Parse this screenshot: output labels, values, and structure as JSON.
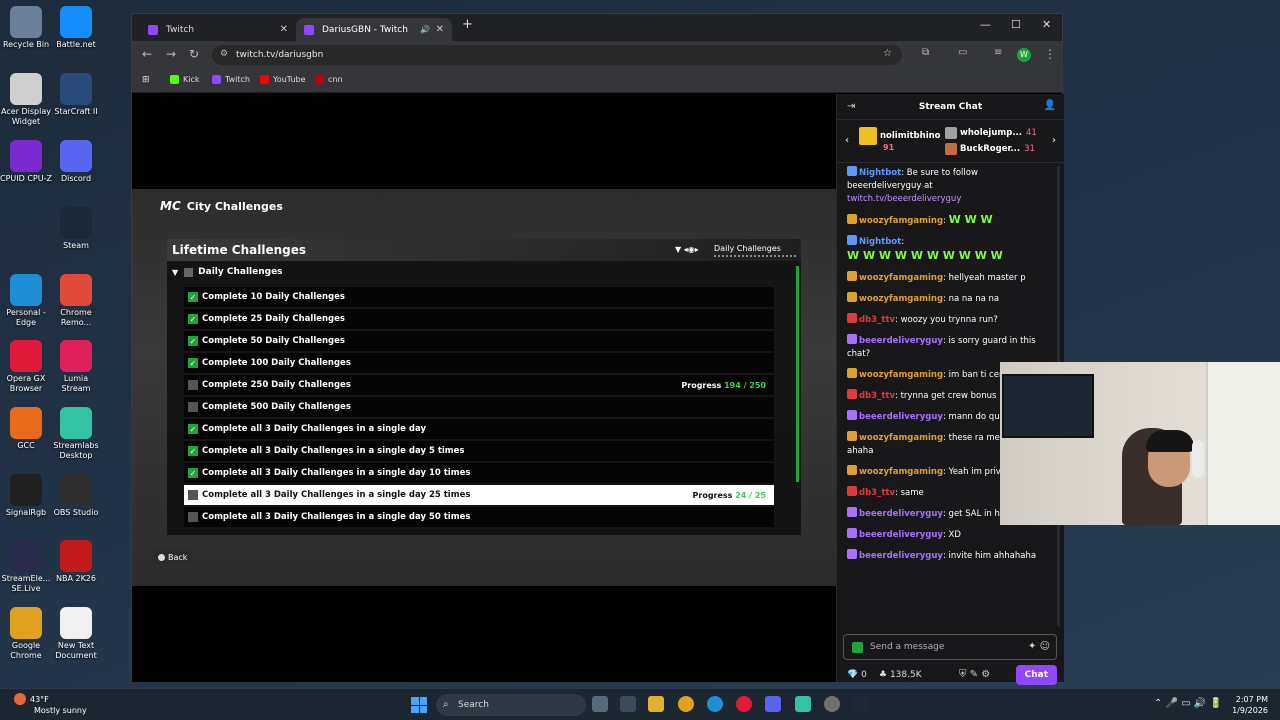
{
  "desktop": {
    "icons": [
      {
        "label": "Recycle Bin",
        "color": "#6b7f99"
      },
      {
        "label": "Battle.net",
        "color": "#148eff"
      },
      {
        "label": "Acer Display Widget",
        "color": "#cfcfcf"
      },
      {
        "label": "StarCraft II",
        "color": "#2a4a7a"
      },
      {
        "label": "CPUID CPU-Z",
        "color": "#7a2ad0"
      },
      {
        "label": "Discord",
        "color": "#5865f2"
      },
      {
        "label": "Steam",
        "color": "#1b2838"
      },
      {
        "label": "Personal - Edge",
        "color": "#1e8fd6"
      },
      {
        "label": "Chrome Remo...",
        "color": "#e04a3a"
      },
      {
        "label": "Opera GX Browser",
        "color": "#e01a3a"
      },
      {
        "label": "Lumia Stream",
        "color": "#e0205a"
      },
      {
        "label": "GCC",
        "color": "#e86a1a"
      },
      {
        "label": "Streamlabs Desktop",
        "color": "#31c3a2"
      },
      {
        "label": "SignalRgb",
        "color": "#202020"
      },
      {
        "label": "OBS Studio",
        "color": "#303030"
      },
      {
        "label": "StreamEle... SE.Live",
        "color": "#2a2a4a"
      },
      {
        "label": "NBA 2K26",
        "color": "#c01a1a"
      },
      {
        "label": "Google Chrome",
        "color": "#e0a020"
      },
      {
        "label": "New Text Document",
        "color": "#f0f0f0"
      }
    ]
  },
  "browser": {
    "tabs": [
      {
        "title": "Twitch",
        "close": "✕"
      },
      {
        "title": "DariusGBN - Twitch",
        "close": "✕",
        "audio": "🔊"
      }
    ],
    "new_tab": "+",
    "window_controls": {
      "minimize": "—",
      "maximize": "☐",
      "close": "✕"
    },
    "url": "twitch.tv/dariusgbn",
    "nav": {
      "back": "←",
      "forward": "→",
      "reload": "↻"
    },
    "profile_initial": "W",
    "bookmarks": [
      {
        "label": "Kick",
        "color": "#53fc18"
      },
      {
        "label": "Twitch",
        "color": "#9146ff"
      },
      {
        "label": "YouTube",
        "color": "#ff0000"
      },
      {
        "label": "cnn",
        "color": "#cc0000"
      }
    ]
  },
  "game": {
    "logo": "MC",
    "title": "City Challenges",
    "panel_title": "Lifetime Challenges",
    "category": "Daily Challenges",
    "section": "Daily Challenges",
    "rows": [
      {
        "label": "Complete 10 Daily Challenges",
        "done": true,
        "progress_label": "",
        "progress_value": ""
      },
      {
        "label": "Complete 25 Daily Challenges",
        "done": true,
        "progress_label": "",
        "progress_value": ""
      },
      {
        "label": "Complete 50 Daily Challenges",
        "done": true,
        "progress_label": "",
        "progress_value": ""
      },
      {
        "label": "Complete 100 Daily Challenges",
        "done": true,
        "progress_label": "",
        "progress_value": ""
      },
      {
        "label": "Complete 250 Daily Challenges",
        "done": false,
        "progress_label": "Progress",
        "progress_value": "194 / 250"
      },
      {
        "label": "Complete 500 Daily Challenges",
        "done": false,
        "progress_label": "",
        "progress_value": ""
      },
      {
        "label": "Complete all 3 Daily Challenges in a single day",
        "done": true,
        "progress_label": "",
        "progress_value": ""
      },
      {
        "label": "Complete all 3 Daily Challenges in a single day 5 times",
        "done": true,
        "progress_label": "",
        "progress_value": ""
      },
      {
        "label": "Complete all 3 Daily Challenges in a single day 10 times",
        "done": true,
        "progress_label": "",
        "progress_value": ""
      },
      {
        "label": "Complete all 3 Daily Challenges in a single day 25 times",
        "done": false,
        "selected": true,
        "progress_label": "Progress",
        "progress_value": "24 / 25"
      },
      {
        "label": "Complete all 3 Daily Challenges in a single day 50 times",
        "done": false,
        "progress_label": "",
        "progress_value": ""
      }
    ],
    "back_label": "Back"
  },
  "chat": {
    "title": "Stream Chat",
    "leaders": [
      {
        "name": "nolimitbhino",
        "count": "91",
        "color": "#f0c020"
      },
      {
        "name": "wholejump...",
        "count": "41",
        "color": "#a0a0a0"
      },
      {
        "name": "BuckRoger...",
        "count": "31",
        "color": "#c07040"
      }
    ],
    "messages": [
      {
        "user": "Nightbot",
        "color": "#5c9aff",
        "text": "Be sure to follow beeerdeliveryguy at",
        "link": "twitch.tv/beeerdeliveryguy"
      },
      {
        "user": "woozyfamgaming",
        "color": "#e0a030",
        "text": "",
        "emotes": "W W W"
      },
      {
        "user": "Nightbot",
        "color": "#5c9aff",
        "text": "",
        "emotes": "W W W W W W W W W W"
      },
      {
        "user": "woozyfamgaming",
        "color": "#e0a030",
        "text": "hellyeah master p"
      },
      {
        "user": "woozyfamgaming",
        "color": "#e0a030",
        "text": "na na na na"
      },
      {
        "user": "db3_ttv",
        "color": "#e03a3a",
        "text": "woozy you trynna run?"
      },
      {
        "user": "beeerdeliveryguy",
        "color": "#a970ff",
        "text": "is sorry guard in this chat?"
      },
      {
        "user": "woozyfamgaming",
        "color": "#e0a030",
        "text": "im ban ti central lol"
      },
      {
        "user": "db3_ttv",
        "color": "#e03a3a",
        "text": "trynna get crew bonus"
      },
      {
        "user": "beeerdeliveryguy",
        "color": "#a970ff",
        "text": "mann do quit"
      },
      {
        "user": "woozyfamgaming",
        "color": "#e0a030",
        "text": "these ra me dashin ahaha"
      },
      {
        "user": "woozyfamgaming",
        "color": "#e0a030",
        "text": "Yeah im privates 10s"
      },
      {
        "user": "db3_ttv",
        "color": "#e03a3a",
        "text": "same"
      },
      {
        "user": "beeerdeliveryguy",
        "color": "#a970ff",
        "text": "get SAL in here!"
      },
      {
        "user": "beeerdeliveryguy",
        "color": "#a970ff",
        "text": "XD"
      },
      {
        "user": "beeerdeliveryguy",
        "color": "#a970ff",
        "text": "invite him ahhahaha"
      }
    ],
    "input_placeholder": "Send a message",
    "bits": "0",
    "points": "138.5K",
    "chat_button": "Chat"
  },
  "taskbar": {
    "temp": "43°F",
    "weather": "Mostly sunny",
    "search": "Search",
    "time": "2:07 PM",
    "date": "1/9/2026"
  }
}
